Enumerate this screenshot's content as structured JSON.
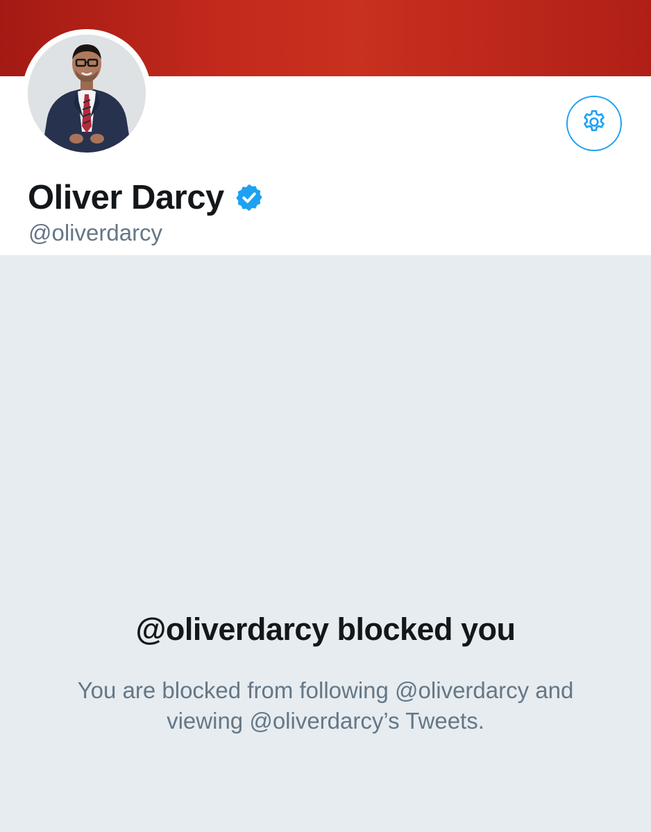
{
  "profile": {
    "display_name": "Oliver Darcy",
    "handle": "@oliverdarcy",
    "verified": true
  },
  "icons": {
    "settings": "gear-icon",
    "verified": "verified-badge-icon"
  },
  "blocked_notice": {
    "title": "@oliverdarcy blocked you",
    "message": "You are blocked from following @oliverdarcy and viewing @oliverdarcy’s Tweets."
  },
  "colors": {
    "banner": "#c42a1c",
    "accent": "#1da1f2",
    "page_background": "#e6ecf0",
    "primary_text": "#14171a",
    "secondary_text": "#657786"
  }
}
